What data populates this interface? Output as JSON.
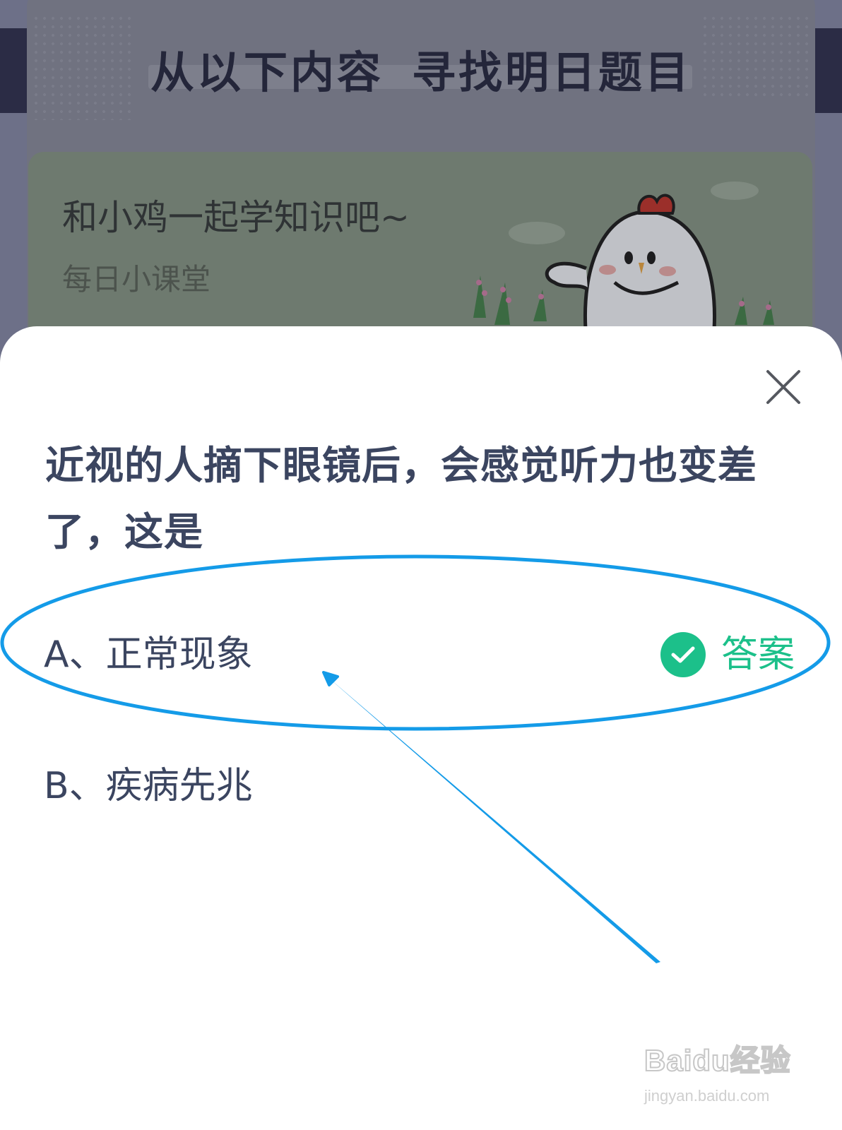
{
  "background": {
    "banner_title_part1": "从以下内容",
    "banner_title_part2": "寻找明日题目",
    "card_title": "和小鸡一起学知识吧~",
    "card_subtitle": "每日小课堂"
  },
  "sheet": {
    "question": "近视的人摘下眼镜后，会感觉听力也变差了，这是",
    "options": [
      {
        "label": "A、正常现象",
        "is_answer": true
      },
      {
        "label": "B、疾病先兆",
        "is_answer": false
      }
    ],
    "answer_label": "答案"
  },
  "watermark": {
    "brand": "Baidu经验",
    "url": "jingyan.baidu.com"
  },
  "colors": {
    "accent_green": "#1cc08a",
    "question_text": "#3b4560",
    "annotation_blue": "#149be8"
  },
  "icons": {
    "close": "close-icon",
    "check": "check-circle-icon"
  }
}
